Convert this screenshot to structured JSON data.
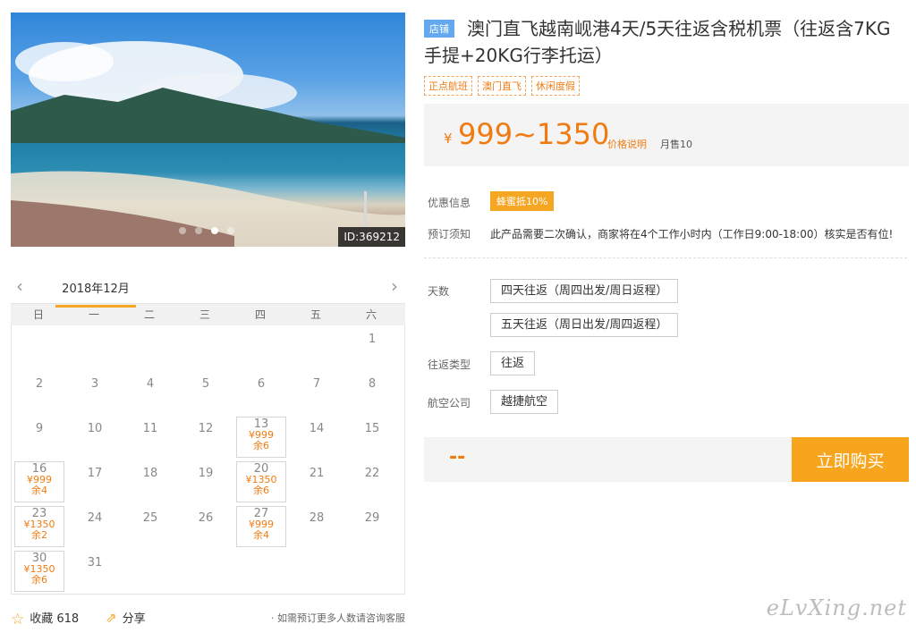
{
  "photo": {
    "id_label": "ID:369212"
  },
  "product": {
    "shop_tag": "店铺",
    "title": "澳门直飞越南岘港4天/5天往返含税机票（往返含7KG手提+20KG行李托运）",
    "labels": [
      "正点航班",
      "澳门直飞",
      "休闲度假"
    ],
    "currency": "¥",
    "price": "999~1350",
    "price_explain": "价格说明",
    "monthly_sales": "月售10"
  },
  "info": {
    "discount_label": "优惠信息",
    "discount_badge": "蜂蜜抵10%",
    "notice_label": "预订须知",
    "notice_text": "此产品需要二次确认，商家将在4个工作小时内（工作日9:00-18:00）核实是否有位!"
  },
  "options": {
    "days_label": "天数",
    "days": [
      "四天往返（周四出发/周日返程）",
      "五天往返（周日出发/周四返程）"
    ],
    "trip_label": "往返类型",
    "trip": "往返",
    "airline_label": "航空公司",
    "airline": "越捷航空"
  },
  "buy": {
    "total": "--",
    "button": "立即购买"
  },
  "calendar": {
    "prev": "‹",
    "next": "›",
    "month": "2018年12月",
    "weekdays": [
      "日",
      "一",
      "二",
      "三",
      "四",
      "五",
      "六"
    ],
    "days": [
      {
        "d": ""
      },
      {
        "d": ""
      },
      {
        "d": ""
      },
      {
        "d": ""
      },
      {
        "d": ""
      },
      {
        "d": ""
      },
      {
        "d": "1"
      },
      {
        "d": "2"
      },
      {
        "d": "3"
      },
      {
        "d": "4"
      },
      {
        "d": "5"
      },
      {
        "d": "6"
      },
      {
        "d": "7"
      },
      {
        "d": "8"
      },
      {
        "d": "9"
      },
      {
        "d": "10"
      },
      {
        "d": "11"
      },
      {
        "d": "12"
      },
      {
        "d": "13",
        "price": "¥999",
        "left": "余6"
      },
      {
        "d": "14"
      },
      {
        "d": "15"
      },
      {
        "d": "16",
        "price": "¥999",
        "left": "余4"
      },
      {
        "d": "17"
      },
      {
        "d": "18"
      },
      {
        "d": "19"
      },
      {
        "d": "20",
        "price": "¥1350",
        "left": "余6"
      },
      {
        "d": "21"
      },
      {
        "d": "22"
      },
      {
        "d": "23",
        "price": "¥1350",
        "left": "余2"
      },
      {
        "d": "24"
      },
      {
        "d": "25"
      },
      {
        "d": "26"
      },
      {
        "d": "27",
        "price": "¥999",
        "left": "余4"
      },
      {
        "d": "28"
      },
      {
        "d": "29"
      },
      {
        "d": "30",
        "price": "¥1350",
        "left": "余6"
      },
      {
        "d": "31"
      },
      {
        "d": ""
      },
      {
        "d": ""
      },
      {
        "d": ""
      },
      {
        "d": ""
      },
      {
        "d": ""
      }
    ]
  },
  "footer": {
    "favorite": "收藏 618",
    "share": "分享",
    "hint": "· 如需预订更多人数请咨询客服"
  },
  "watermark": "eLvXing.net"
}
